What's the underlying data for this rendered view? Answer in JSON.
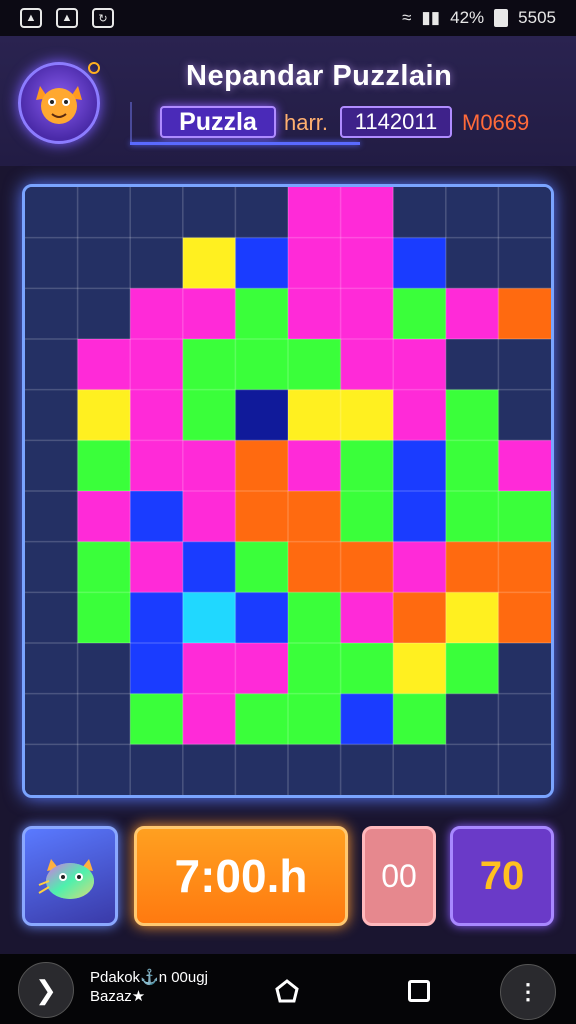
{
  "status_bar": {
    "icons": [
      "image-icon",
      "image-icon",
      "sync-icon"
    ],
    "battery_percent": "42%",
    "clock": "5505"
  },
  "header": {
    "title": "Nepandar Puzzlain",
    "mode_badge": "Puzzla",
    "mode_label": "harr.",
    "score": "1142011",
    "extra": "M0669"
  },
  "board": {
    "rows": 12,
    "cols": 10,
    "colors": {
      "empty": "#243064",
      "magenta": "#ff2ad8",
      "green": "#3aff3a",
      "yellow": "#fff020",
      "blue": "#1a3cff",
      "orange": "#ff6a10",
      "cyan": "#20d8ff",
      "navy": "#101a9a"
    }
  },
  "controls": {
    "timer": "7:00.h",
    "counter": "00",
    "moves": "70"
  },
  "nav": {
    "text_line1": "Pdakok⚓n 00ugj",
    "text_line2": "Bazaz★"
  }
}
